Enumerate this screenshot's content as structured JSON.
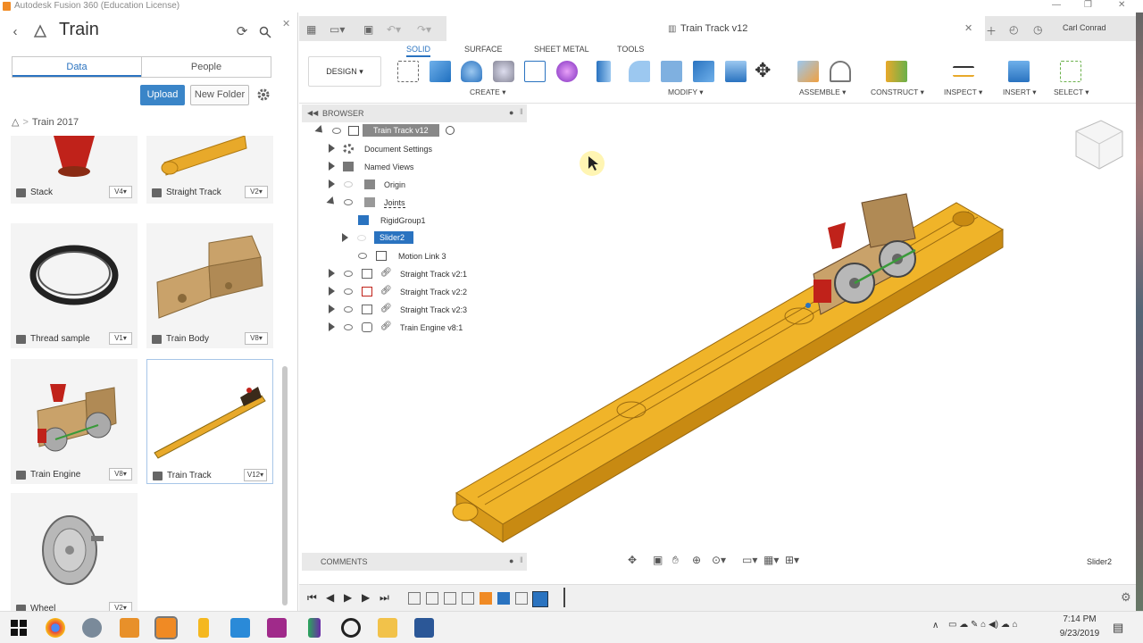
{
  "window": {
    "title": "Autodesk Fusion 360 (Education License)",
    "minimize": "—",
    "restore": "❐",
    "close": "✕"
  },
  "data_panel": {
    "title": "Train",
    "tabs": [
      {
        "label": "Data",
        "active": true
      },
      {
        "label": "People",
        "active": false
      }
    ],
    "upload_label": "Upload",
    "new_folder_label": "New Folder",
    "breadcrumb": "Train 2017",
    "items": [
      {
        "name": "Stack",
        "version": "V4▾"
      },
      {
        "name": "Straight Track",
        "version": "V2▾"
      },
      {
        "name": "Thread sample",
        "version": "V1▾"
      },
      {
        "name": "Train Body",
        "version": "V8▾"
      },
      {
        "name": "Train Engine",
        "version": "V8▾"
      },
      {
        "name": "Train Track",
        "version": "V12▾",
        "selected": true
      },
      {
        "name": "Wheel",
        "version": "V2▾"
      }
    ]
  },
  "document_tab": {
    "title": "Train Track v12"
  },
  "user": {
    "name": "Carl Conrad"
  },
  "ribbon": {
    "tabs": [
      {
        "label": "SOLID",
        "active": true
      },
      {
        "label": "SURFACE",
        "active": false
      },
      {
        "label": "SHEET METAL",
        "active": false
      },
      {
        "label": "TOOLS",
        "active": false
      }
    ],
    "workspace": "DESIGN ▾",
    "groups": [
      {
        "label": "CREATE ▾"
      },
      {
        "label": "MODIFY ▾"
      },
      {
        "label": "ASSEMBLE ▾"
      },
      {
        "label": "CONSTRUCT ▾"
      },
      {
        "label": "INSPECT ▾"
      },
      {
        "label": "INSERT ▾"
      },
      {
        "label": "SELECT ▾"
      }
    ]
  },
  "browser": {
    "title": "BROWSER",
    "root": "Train Track v12",
    "rows": [
      {
        "label": "Document Settings"
      },
      {
        "label": "Named Views"
      },
      {
        "label": "Origin"
      },
      {
        "label": "Joints"
      },
      {
        "label": "RigidGroup1"
      },
      {
        "label": "Slider2",
        "selected": true
      },
      {
        "label": "Motion Link 3"
      },
      {
        "label": "Straight Track v2:1"
      },
      {
        "label": "Straight Track v2:2"
      },
      {
        "label": "Straight Track v2:3"
      },
      {
        "label": "Train Engine v8:1"
      }
    ]
  },
  "comments": {
    "title": "COMMENTS"
  },
  "status": {
    "selection": "Slider2"
  },
  "taskbar": {
    "time": "7:14 PM",
    "date": "9/23/2019"
  },
  "colors": {
    "accent": "#2a73c0",
    "track": "#e8a92a",
    "selected_row": "#2a73c0"
  }
}
